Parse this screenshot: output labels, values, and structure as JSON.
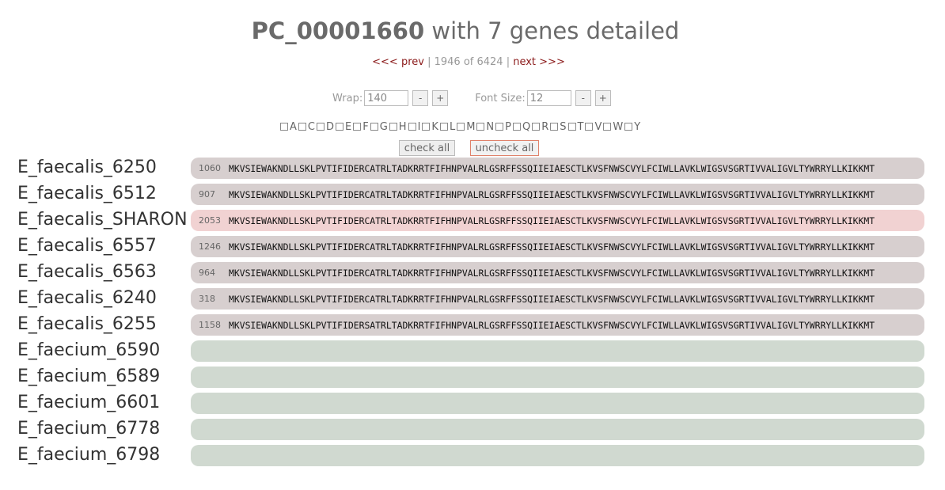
{
  "title": {
    "id": "PC_00001660",
    "rest": " with 7 genes detailed"
  },
  "nav": {
    "prev": "<<< prev",
    "sep1": " | ",
    "position": "1946 of 6424",
    "sep2": " | ",
    "next": "next >>>"
  },
  "wrap": {
    "label": "Wrap:",
    "value": "140",
    "minus": "-",
    "plus": "+"
  },
  "font_size": {
    "label": "Font Size:",
    "value": "12",
    "minus": "-",
    "plus": "+"
  },
  "amino_acids": [
    "A",
    "C",
    "D",
    "E",
    "F",
    "G",
    "H",
    "I",
    "K",
    "L",
    "M",
    "N",
    "P",
    "Q",
    "R",
    "S",
    "T",
    "V",
    "W",
    "Y"
  ],
  "buttons": {
    "check_all": "check all",
    "uncheck_all": "uncheck all"
  },
  "genes": [
    {
      "name": "E_faecalis_6250",
      "num": "1060",
      "seq": "MKVSIEWAKNDLLSKLPVTIFIDERCATRLTADKRRTFIFHNPVALRLGSRFFSSQIIEIAESCTLKVSFNWSCVYLFCIWLLAVKLWIGSVSGRTIVVALIGVLTYWRRYLLKIKKMT",
      "style": "gene"
    },
    {
      "name": "E_faecalis_6512",
      "num": "907",
      "seq": "MKVSIEWAKNDLLSKLPVTIFIDERCATRLTADKRRTFIFHNPVALRLGSRFFSSQIIEIAESCTLKVSFNWSCVYLFCIWLLAVKLWIGSVSGRTIVVALIGVLTYWRRYLLKIKKMT",
      "style": "gene"
    },
    {
      "name": "E_faecalis_SHARON",
      "num": "2053",
      "seq": "MKVSIEWAKNDLLSKLPVTIFIDERCATRLTADKRRTFIFHNPVALRLGSRFFSSQIIEIAESCTLKVSFNWSCVYLFCIWLLAVKLWIGSVSGRTIVVALIGVLTYWRRYLLKIKKMT",
      "style": "highlight"
    },
    {
      "name": "E_faecalis_6557",
      "num": "1246",
      "seq": "MKVSIEWAKNDLLSKLPVTIFIDERCATRLTADKRRTFIFHNPVALRLGSRFFSSQIIEIAESCTLKVSFNWSCVYLFCIWLLAVKLWIGSVSGRTIVVALIGVLTYWRRYLLKIKKMT",
      "style": "gene"
    },
    {
      "name": "E_faecalis_6563",
      "num": "964",
      "seq": "MKVSIEWAKNDLLSKLPVTIFIDERCATRLTADKRRTFIFHNPVALRLGSRFFSSQIIEIAESCTLKVSFNWSCVYLFCIWLLAVKLWIGSVSGRTIVVALIGVLTYWRRYLLKIKKMT",
      "style": "gene"
    },
    {
      "name": "E_faecalis_6240",
      "num": "318",
      "seq": "MKVSIEWAKNDLLSKLPVTIFIDERCATRLTADKRRTFIFHNPVALRLGSRFFSSQIIEIAESCTLKVSFNWSCVYLFCIWLLAVKLWIGSVSGRTIVVALIGVLTYWRRYLLKIKKMT",
      "style": "gene"
    },
    {
      "name": "E_faecalis_6255",
      "num": "1158",
      "seq": "MKVSIEWAKNDLLSKLPVTIFIDERSATRLTADKRRTFIFHNPVALRLGSRFFSSQIIEIAESCTLKVSFNWSCVYLFCIWLLAVKLWIGSVSGRTIVVALIGVLTYWRRYLLKIKKMT",
      "style": "gene"
    },
    {
      "name": "E_faecium_6590",
      "num": "",
      "seq": "",
      "style": "empty"
    },
    {
      "name": "E_faecium_6589",
      "num": "",
      "seq": "",
      "style": "empty"
    },
    {
      "name": "E_faecium_6601",
      "num": "",
      "seq": "",
      "style": "empty"
    },
    {
      "name": "E_faecium_6778",
      "num": "",
      "seq": "",
      "style": "empty"
    },
    {
      "name": "E_faecium_6798",
      "num": "",
      "seq": "",
      "style": "empty"
    }
  ],
  "colors": {
    "gene_row": "#d7cfcf",
    "highlight_row": "#f1d2d2",
    "empty_row": "#d0d9d0",
    "link": "#8b1a1a"
  }
}
